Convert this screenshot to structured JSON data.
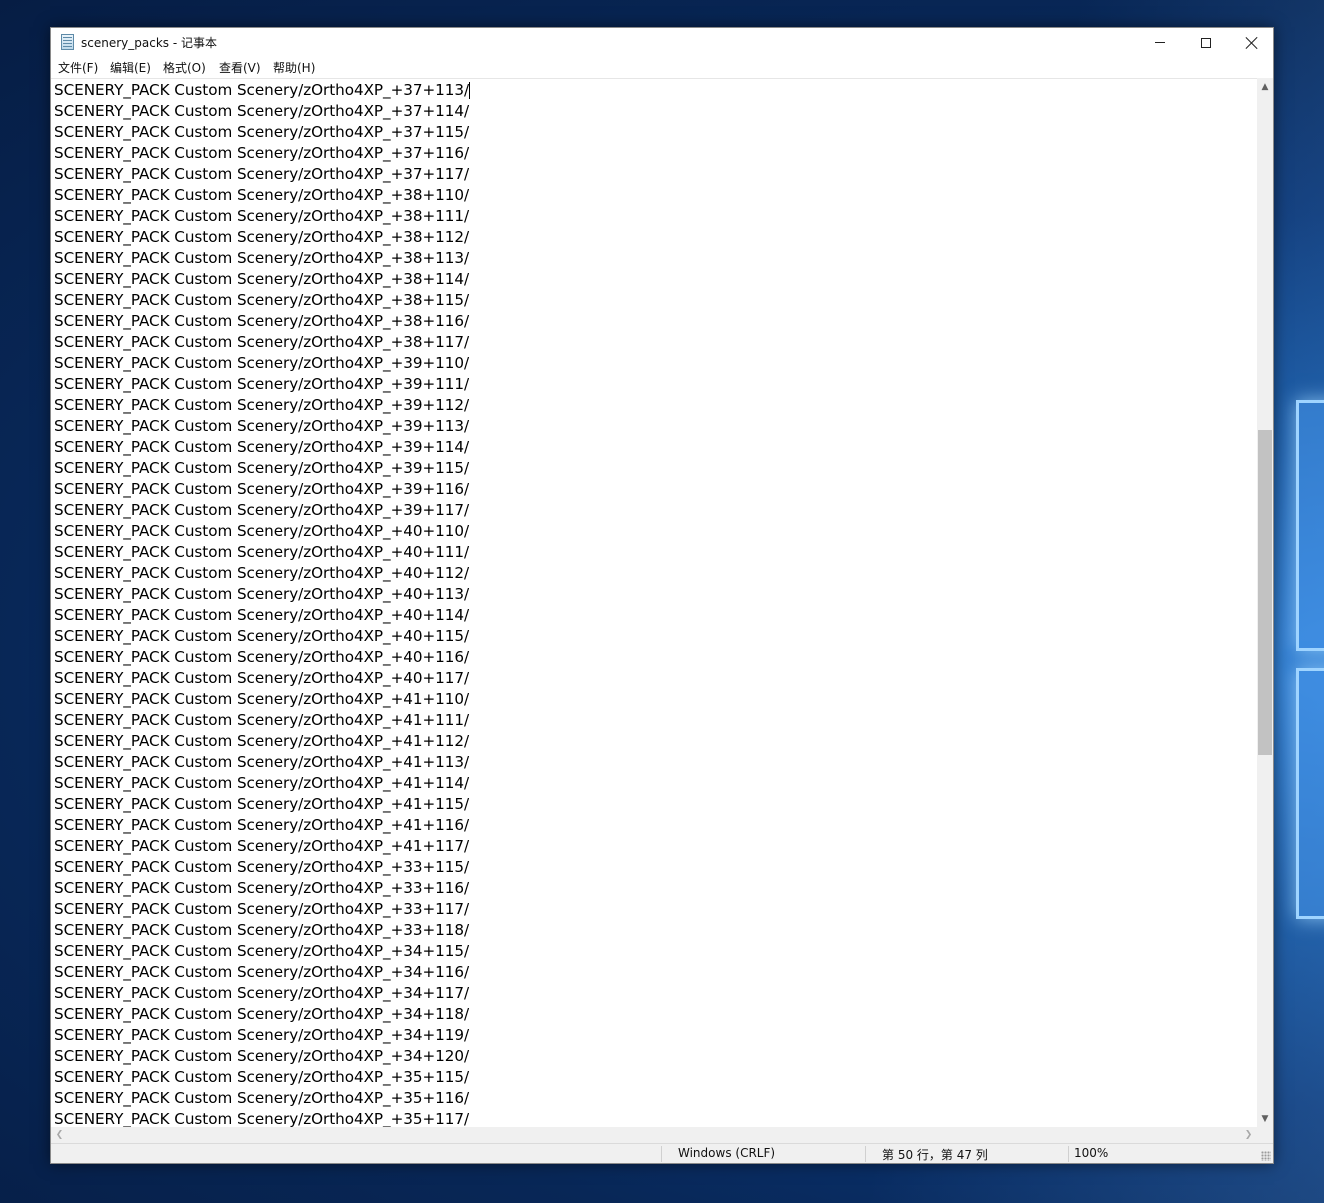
{
  "window": {
    "title": "scenery_packs - 记事本",
    "icon": "notepad-icon",
    "controls": [
      "minimize-icon",
      "maximize-icon",
      "close-icon"
    ]
  },
  "menu": {
    "items": [
      "文件(F)",
      "编辑(E)",
      "格式(O)",
      "查看(V)",
      "帮助(H)"
    ]
  },
  "editor": {
    "lines": [
      "SCENERY_PACK Custom Scenery/zOrtho4XP_+37+113/",
      "SCENERY_PACK Custom Scenery/zOrtho4XP_+37+114/",
      "SCENERY_PACK Custom Scenery/zOrtho4XP_+37+115/",
      "SCENERY_PACK Custom Scenery/zOrtho4XP_+37+116/",
      "SCENERY_PACK Custom Scenery/zOrtho4XP_+37+117/",
      "SCENERY_PACK Custom Scenery/zOrtho4XP_+38+110/",
      "SCENERY_PACK Custom Scenery/zOrtho4XP_+38+111/",
      "SCENERY_PACK Custom Scenery/zOrtho4XP_+38+112/",
      "SCENERY_PACK Custom Scenery/zOrtho4XP_+38+113/",
      "SCENERY_PACK Custom Scenery/zOrtho4XP_+38+114/",
      "SCENERY_PACK Custom Scenery/zOrtho4XP_+38+115/",
      "SCENERY_PACK Custom Scenery/zOrtho4XP_+38+116/",
      "SCENERY_PACK Custom Scenery/zOrtho4XP_+38+117/",
      "SCENERY_PACK Custom Scenery/zOrtho4XP_+39+110/",
      "SCENERY_PACK Custom Scenery/zOrtho4XP_+39+111/",
      "SCENERY_PACK Custom Scenery/zOrtho4XP_+39+112/",
      "SCENERY_PACK Custom Scenery/zOrtho4XP_+39+113/",
      "SCENERY_PACK Custom Scenery/zOrtho4XP_+39+114/",
      "SCENERY_PACK Custom Scenery/zOrtho4XP_+39+115/",
      "SCENERY_PACK Custom Scenery/zOrtho4XP_+39+116/",
      "SCENERY_PACK Custom Scenery/zOrtho4XP_+39+117/",
      "SCENERY_PACK Custom Scenery/zOrtho4XP_+40+110/",
      "SCENERY_PACK Custom Scenery/zOrtho4XP_+40+111/",
      "SCENERY_PACK Custom Scenery/zOrtho4XP_+40+112/",
      "SCENERY_PACK Custom Scenery/zOrtho4XP_+40+113/",
      "SCENERY_PACK Custom Scenery/zOrtho4XP_+40+114/",
      "SCENERY_PACK Custom Scenery/zOrtho4XP_+40+115/",
      "SCENERY_PACK Custom Scenery/zOrtho4XP_+40+116/",
      "SCENERY_PACK Custom Scenery/zOrtho4XP_+40+117/",
      "SCENERY_PACK Custom Scenery/zOrtho4XP_+41+110/",
      "SCENERY_PACK Custom Scenery/zOrtho4XP_+41+111/",
      "SCENERY_PACK Custom Scenery/zOrtho4XP_+41+112/",
      "SCENERY_PACK Custom Scenery/zOrtho4XP_+41+113/",
      "SCENERY_PACK Custom Scenery/zOrtho4XP_+41+114/",
      "SCENERY_PACK Custom Scenery/zOrtho4XP_+41+115/",
      "SCENERY_PACK Custom Scenery/zOrtho4XP_+41+116/",
      "SCENERY_PACK Custom Scenery/zOrtho4XP_+41+117/",
      "SCENERY_PACK Custom Scenery/zOrtho4XP_+33+115/",
      "SCENERY_PACK Custom Scenery/zOrtho4XP_+33+116/",
      "SCENERY_PACK Custom Scenery/zOrtho4XP_+33+117/",
      "SCENERY_PACK Custom Scenery/zOrtho4XP_+33+118/",
      "SCENERY_PACK Custom Scenery/zOrtho4XP_+34+115/",
      "SCENERY_PACK Custom Scenery/zOrtho4XP_+34+116/",
      "SCENERY_PACK Custom Scenery/zOrtho4XP_+34+117/",
      "SCENERY_PACK Custom Scenery/zOrtho4XP_+34+118/",
      "SCENERY_PACK Custom Scenery/zOrtho4XP_+34+119/",
      "SCENERY_PACK Custom Scenery/zOrtho4XP_+34+120/",
      "SCENERY_PACK Custom Scenery/zOrtho4XP_+35+115/",
      "SCENERY_PACK Custom Scenery/zOrtho4XP_+35+116/",
      "SCENERY_PACK Custom Scenery/zOrtho4XP_+35+117/"
    ]
  },
  "statusbar": {
    "encoding": "Windows (CRLF)",
    "position": "第 50 行，第 47 列",
    "zoom": "100%"
  },
  "scrollbars": {
    "vertical_position": 0.33,
    "vertical_visible_fraction": 0.32
  }
}
